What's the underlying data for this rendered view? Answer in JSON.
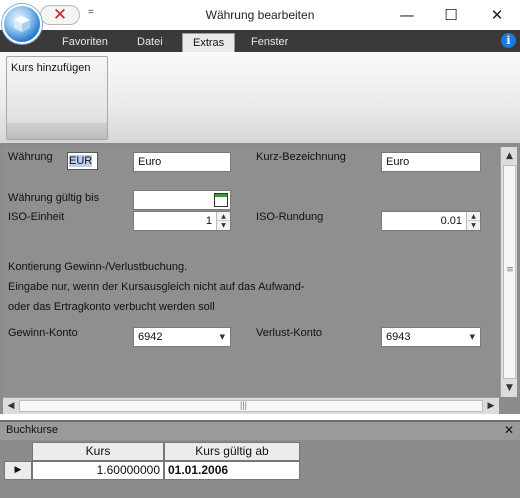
{
  "window": {
    "title": "Währung bearbeiten",
    "minimize": "—",
    "maximize": "☐",
    "close": "✕",
    "qa_more": "="
  },
  "ribbon": {
    "tabs": [
      "Favoriten",
      "Datei",
      "Extras",
      "Fenster"
    ],
    "active_tab": "Extras",
    "buttons": {
      "add_rate": "Kurs hinzufügen"
    }
  },
  "form": {
    "waehrung_label": "Währung",
    "waehrung_code": "EUR",
    "waehrung_name": "Euro",
    "kurzbez_label": "Kurz-Bezeichnung",
    "kurzbez_value": "Euro",
    "gueltig_bis_label": "Währung gültig bis",
    "gueltig_bis_value": "",
    "iso_einheit_label": "ISO-Einheit",
    "iso_einheit_value": "1",
    "iso_rundung_label": "ISO-Rundung",
    "iso_rundung_value": "0.01",
    "kontierung_text1": "Kontierung Gewinn-/Verlustbuchung.",
    "kontierung_text2": "Eingabe nur, wenn der Kursausgleich nicht auf das Aufwand-",
    "kontierung_text3": "oder das Ertragkonto verbucht werden soll",
    "gewinn_label": "Gewinn-Konto",
    "gewinn_value": "6942",
    "verlust_label": "Verlust-Konto",
    "verlust_value": "6943"
  },
  "buchkurse": {
    "title": "Buchkurse",
    "columns": [
      "Kurs",
      "Kurs gültig ab"
    ],
    "rows": [
      {
        "kurs": "1.60000000",
        "gueltig_ab": "01.01.2006"
      }
    ]
  },
  "icons": {
    "app": "app-cube-icon",
    "quick_cancel": "red-x-icon",
    "info": "info-icon",
    "calendar": "calendar-icon"
  },
  "colors": {
    "ribbon_dark": "#3a3a3a",
    "form_bg": "#8f8f8f",
    "info_blue": "#1e7ad8",
    "cancel_red": "#d42020"
  }
}
